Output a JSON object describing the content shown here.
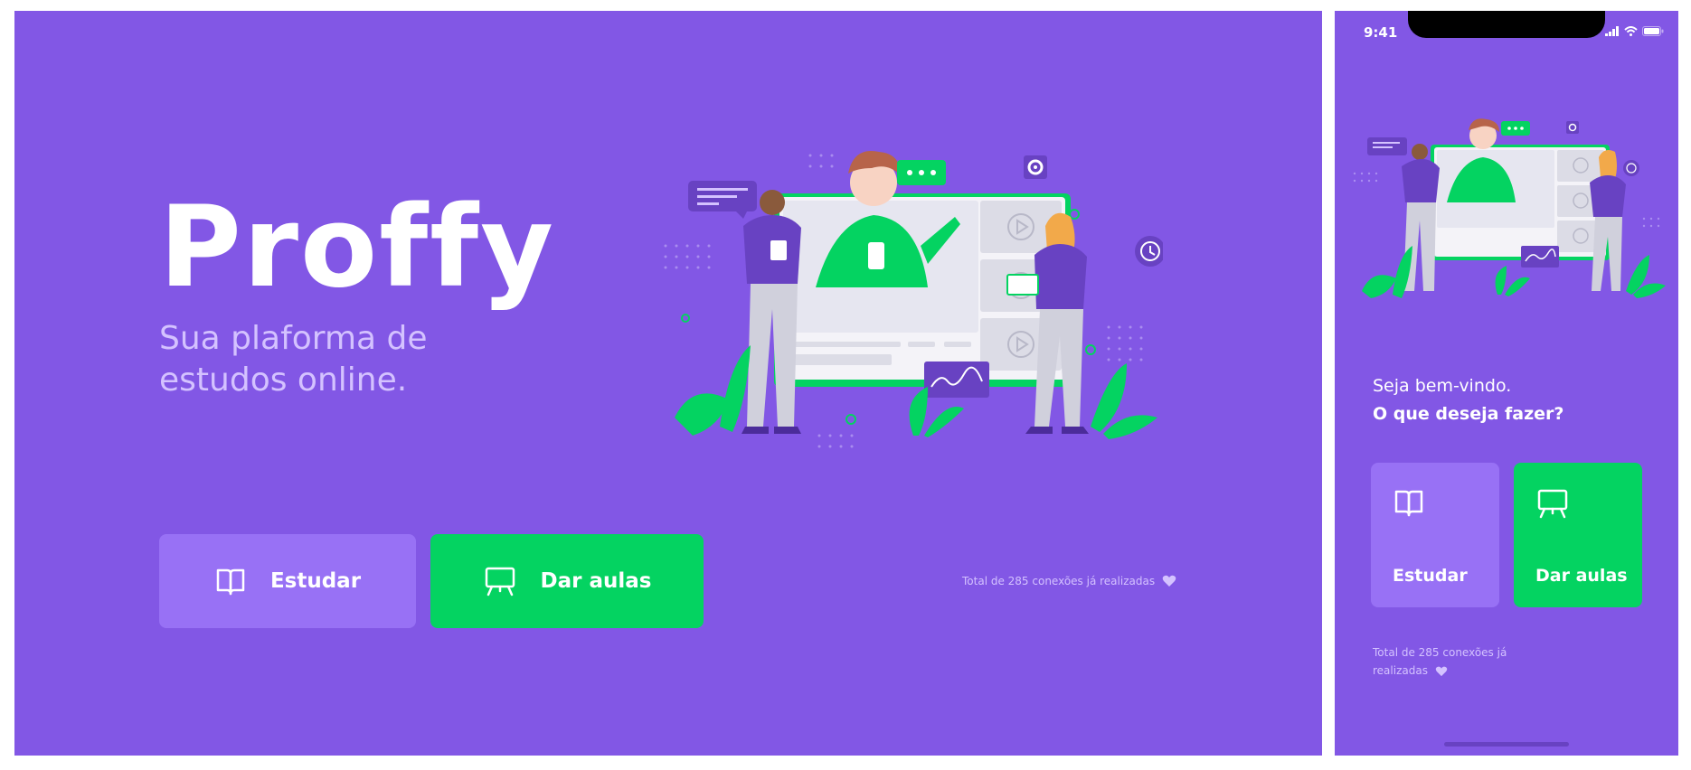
{
  "desktop": {
    "logo": "Proffy",
    "tagline": "Sua plaforma de estudos online.",
    "buttons": {
      "study": "Estudar",
      "teach": "Dar aulas"
    },
    "connections": "Total de 285 conexões já realizadas"
  },
  "mobile": {
    "status_time": "9:41",
    "welcome": "Seja bem-vindo.",
    "question": "O que deseja fazer?",
    "cards": {
      "study": "Estudar",
      "teach": "Dar aulas"
    },
    "connections": "Total de 285 conexões já realizadas"
  },
  "colors": {
    "primary": "#8257e5",
    "primary_lighter": "#9871f5",
    "secondary": "#04d361",
    "text_light": "#d4c2ff",
    "white": "#ffffff"
  },
  "icons": [
    "book-open-icon",
    "presentation-board-icon",
    "heart-icon",
    "signal-icon",
    "wifi-icon",
    "battery-icon",
    "play-icon",
    "gear-icon",
    "clock-icon",
    "chat-bubble-icon"
  ]
}
